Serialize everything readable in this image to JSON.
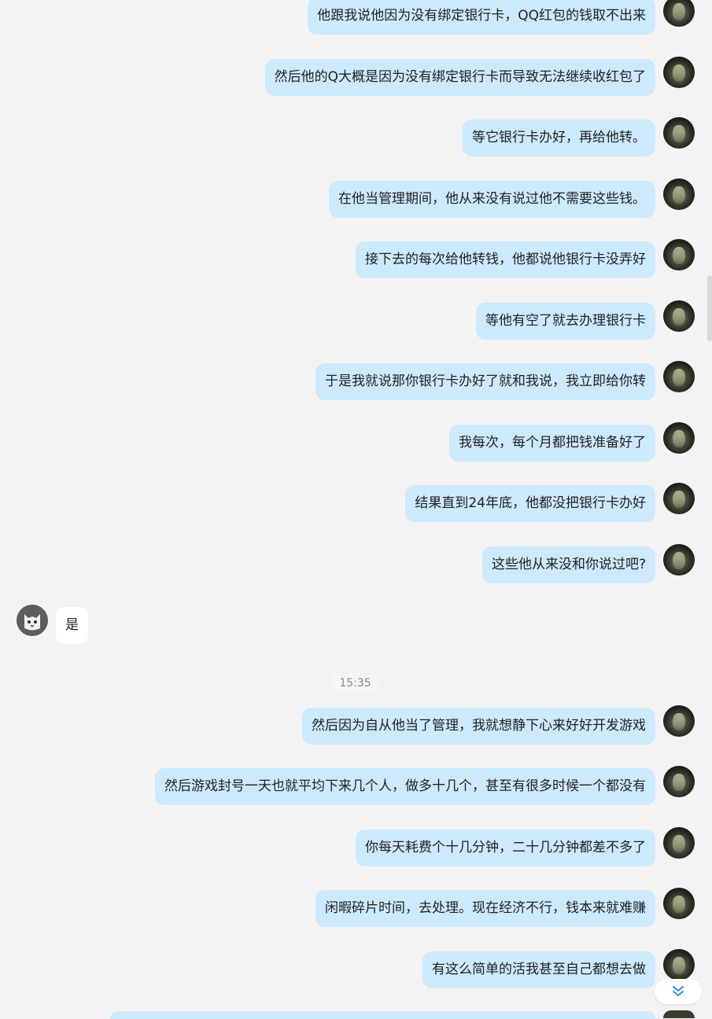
{
  "chat": {
    "messages": [
      {
        "side": "out",
        "text": "他跟我说他因为没有绑定银行卡，QQ红包的钱取不出来"
      },
      {
        "side": "out",
        "text": "然后他的Q大概是因为没有绑定银行卡而导致无法继续收红包了"
      },
      {
        "side": "out",
        "text": "等它银行卡办好，再给他转。"
      },
      {
        "side": "out",
        "text": "在他当管理期间，他从来没有说过他不需要这些钱。"
      },
      {
        "side": "out",
        "text": "接下去的每次给他转钱，他都说他银行卡没弄好"
      },
      {
        "side": "out",
        "text": "等他有空了就去办理银行卡"
      },
      {
        "side": "out",
        "text": "于是我就说那你银行卡办好了就和我说，我立即给你转"
      },
      {
        "side": "out",
        "text": "我每次，每个月都把钱准备好了"
      },
      {
        "side": "out",
        "text": "结果直到24年底，他都没把银行卡办好"
      },
      {
        "side": "out",
        "text": "这些他从来没和你说过吧?"
      },
      {
        "side": "in",
        "text": "是"
      },
      {
        "side": "out",
        "text": "然后因为自从他当了管理，我就想静下心来好好开发游戏"
      },
      {
        "side": "out",
        "text": "然后游戏封号一天也就平均下来几个人，做多十几个，甚至有很多时候一个都没有"
      },
      {
        "side": "out",
        "text": "你每天耗费个十几分钟，二十几分钟都差不多了"
      },
      {
        "side": "out",
        "text": "闲暇碎片时间，去处理。现在经济不行，钱本来就难赚"
      },
      {
        "side": "out",
        "text": "有这么简单的活我甚至自己都想去做"
      }
    ],
    "timestamp": "15:35",
    "colors": {
      "outgoing_bubble": "#cde9fc",
      "incoming_bubble": "#ffffff",
      "background": "#f3f3f3"
    },
    "icons": {
      "scroll_down": "double-chevron-down-icon",
      "incoming_avatar": "cat-avatar-icon"
    }
  }
}
